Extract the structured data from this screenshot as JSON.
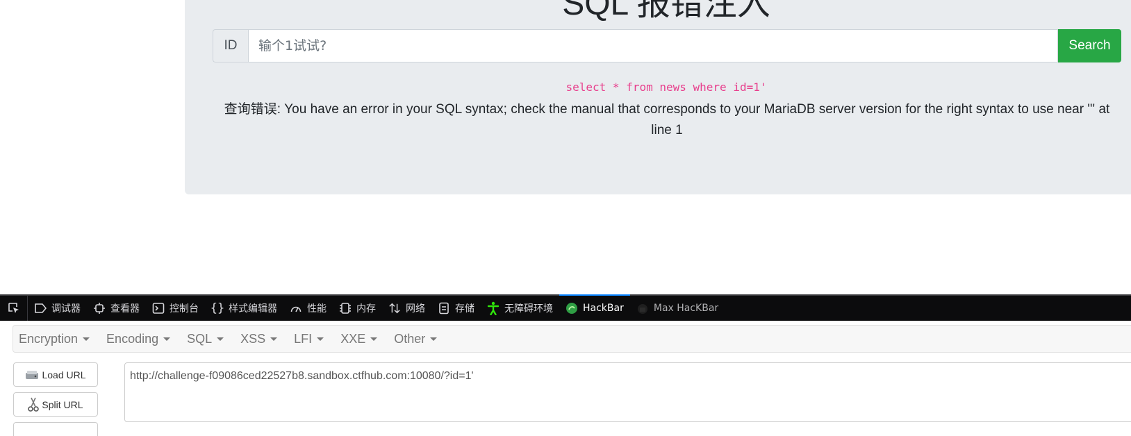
{
  "page": {
    "title": "SQL 报错注入",
    "id_label": "ID",
    "input_placeholder": "输个1试试?",
    "search_label": "Search",
    "query": "select * from news where id=1'",
    "error_prefix": "查询错误",
    "error_text": ": You have an error in your SQL syntax; check the manual that corresponds to your MariaDB server version for the right syntax to use near ''' at line 1"
  },
  "devtools": {
    "tabs": [
      {
        "label": "调试器",
        "icon": "debugger-icon"
      },
      {
        "label": "查看器",
        "icon": "inspector-icon"
      },
      {
        "label": "控制台",
        "icon": "console-icon"
      },
      {
        "label": "样式编辑器",
        "icon": "style-editor-icon"
      },
      {
        "label": "性能",
        "icon": "performance-icon"
      },
      {
        "label": "内存",
        "icon": "memory-icon"
      },
      {
        "label": "网络",
        "icon": "network-icon"
      },
      {
        "label": "存储",
        "icon": "storage-icon"
      },
      {
        "label": "无障碍环境",
        "icon": "accessibility-icon"
      },
      {
        "label": "HackBar",
        "icon": "hackbar-icon",
        "active": true
      },
      {
        "label": "Max HacKBar",
        "icon": "max-hackbar-icon"
      }
    ]
  },
  "hackbar": {
    "menu": [
      "Encryption",
      "Encoding",
      "SQL",
      "XSS",
      "LFI",
      "XXE",
      "Other"
    ],
    "load_url_label": "Load URL",
    "split_url_label": "Split URL",
    "url_value": "http://challenge-f09086ced22527b8.sandbox.ctfhub.com:10080/?id=1'"
  },
  "colors": {
    "search_green": "#28a745",
    "query_pink": "#e83e8c",
    "active_tab_blue": "#0a84ff",
    "accessibility_green": "#30e60b"
  }
}
